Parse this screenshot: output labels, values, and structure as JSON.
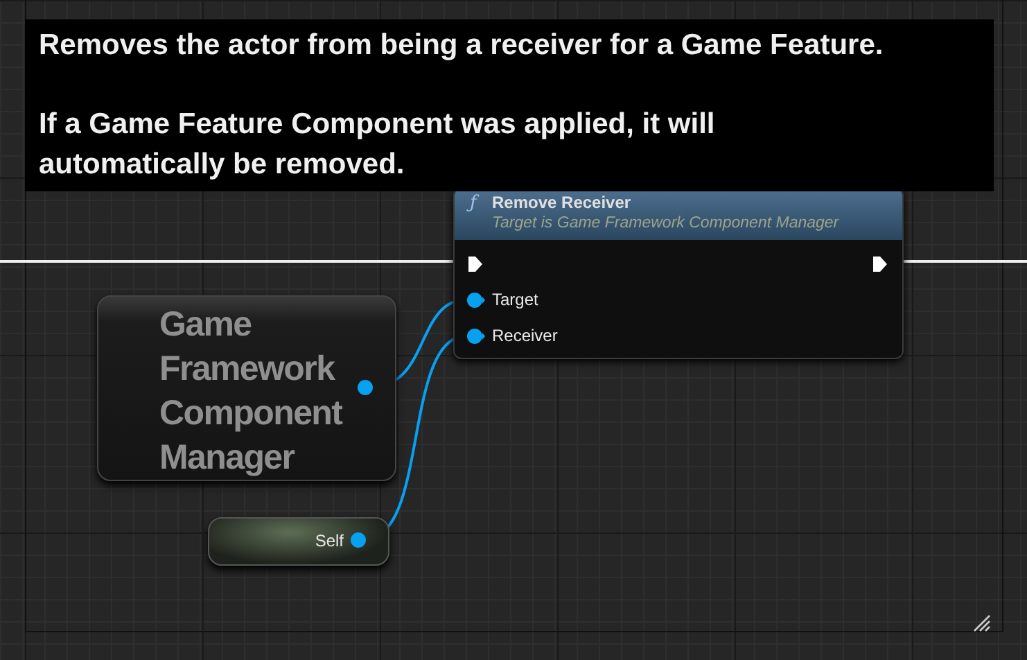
{
  "tooltip": {
    "paragraphs": [
      "Removes the actor from being a receiver for a Game Feature.",
      "If a Game Feature Component was applied, it will automatically be removed."
    ]
  },
  "function_node": {
    "title": "Remove Receiver",
    "subtitle": "Target is Game Framework Component Manager",
    "icon": "ƒ",
    "pins": [
      {
        "kind": "exec"
      },
      {
        "kind": "data",
        "label": "Target"
      },
      {
        "kind": "data",
        "label": "Receiver"
      }
    ]
  },
  "variable_node": {
    "title": "Game Framework Component Manager"
  },
  "self_node": {
    "label": "Self"
  }
}
